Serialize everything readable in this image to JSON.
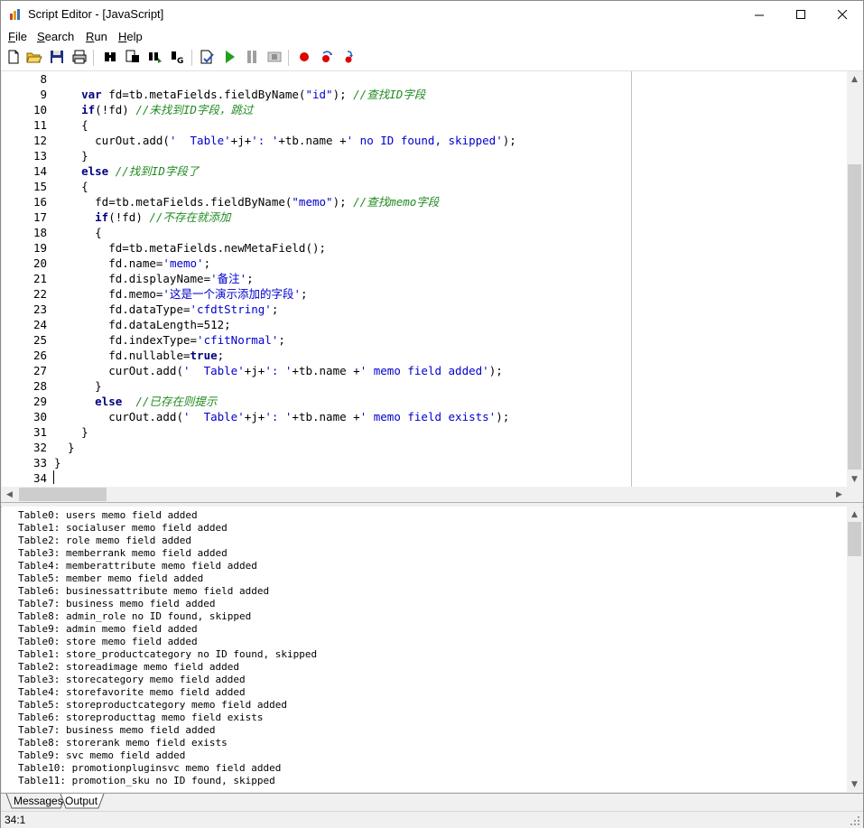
{
  "window": {
    "title": "Script Editor - [JavaScript]",
    "controls": {
      "minimize": "—",
      "maximize": "☐",
      "close": "✕"
    }
  },
  "menu": [
    {
      "label": "File",
      "accel": "F",
      "rest": "ile"
    },
    {
      "label": "Search",
      "accel": "S",
      "rest": "earch"
    },
    {
      "label": "Run",
      "accel": "R",
      "rest": "un"
    },
    {
      "label": "Help",
      "accel": "H",
      "rest": "elp"
    }
  ],
  "toolbar": [
    {
      "name": "new-file-icon"
    },
    {
      "name": "open-folder-icon"
    },
    {
      "name": "save-icon"
    },
    {
      "name": "print-icon"
    },
    {
      "name": "find-icon"
    },
    {
      "name": "find-next-icon"
    },
    {
      "name": "replace-icon"
    },
    {
      "name": "goto-line-icon"
    },
    {
      "name": "check-syntax-icon"
    },
    {
      "name": "run-icon"
    },
    {
      "name": "pause-icon"
    },
    {
      "name": "stop-icon"
    },
    {
      "name": "breakpoint-icon"
    },
    {
      "name": "step-into-icon"
    },
    {
      "name": "step-over-icon"
    }
  ],
  "editor": {
    "lines": [
      {
        "n": "8",
        "t": []
      },
      {
        "n": "9",
        "t": [
          [
            "    ",
            ""
          ],
          [
            "var",
            "kw"
          ],
          [
            " fd=tb.metaFields.fieldByName(",
            ""
          ],
          [
            "\"id\"",
            "str"
          ],
          [
            "); ",
            ""
          ],
          [
            "//查找ID字段",
            "cm"
          ]
        ]
      },
      {
        "n": "10",
        "t": [
          [
            "    ",
            ""
          ],
          [
            "if",
            "kw"
          ],
          [
            "(!fd) ",
            ""
          ],
          [
            "//未找到ID字段，跳过",
            "cm"
          ]
        ]
      },
      {
        "n": "11",
        "t": [
          [
            "    {",
            ""
          ]
        ]
      },
      {
        "n": "12",
        "t": [
          [
            "      curOut.add(",
            ""
          ],
          [
            "'  Table'",
            "str"
          ],
          [
            "+j+",
            ""
          ],
          [
            "': '",
            "str"
          ],
          [
            "+tb.name +",
            ""
          ],
          [
            "' no ID found, skipped'",
            "str"
          ],
          [
            ");",
            ""
          ]
        ]
      },
      {
        "n": "13",
        "t": [
          [
            "    }",
            ""
          ]
        ]
      },
      {
        "n": "14",
        "t": [
          [
            "    ",
            ""
          ],
          [
            "else",
            "kw"
          ],
          [
            " ",
            ""
          ],
          [
            "//找到ID字段了",
            "cm"
          ]
        ]
      },
      {
        "n": "15",
        "t": [
          [
            "    {",
            ""
          ]
        ]
      },
      {
        "n": "16",
        "t": [
          [
            "      fd=tb.metaFields.fieldByName(",
            ""
          ],
          [
            "\"memo\"",
            "str"
          ],
          [
            "); ",
            ""
          ],
          [
            "//查找memo字段",
            "cm"
          ]
        ]
      },
      {
        "n": "17",
        "t": [
          [
            "      ",
            ""
          ],
          [
            "if",
            "kw"
          ],
          [
            "(!fd) ",
            ""
          ],
          [
            "//不存在就添加",
            "cm"
          ]
        ]
      },
      {
        "n": "18",
        "t": [
          [
            "      {",
            ""
          ]
        ]
      },
      {
        "n": "19",
        "t": [
          [
            "        fd=tb.metaFields.newMetaField();",
            ""
          ]
        ]
      },
      {
        "n": "20",
        "t": [
          [
            "        fd.name=",
            ""
          ],
          [
            "'memo'",
            "str"
          ],
          [
            ";",
            ""
          ]
        ]
      },
      {
        "n": "21",
        "t": [
          [
            "        fd.displayName=",
            ""
          ],
          [
            "'备注'",
            "str"
          ],
          [
            ";",
            ""
          ]
        ]
      },
      {
        "n": "22",
        "t": [
          [
            "        fd.memo=",
            ""
          ],
          [
            "'这是一个演示添加的字段'",
            "str"
          ],
          [
            ";",
            ""
          ]
        ]
      },
      {
        "n": "23",
        "t": [
          [
            "        fd.dataType=",
            ""
          ],
          [
            "'cfdtString'",
            "str"
          ],
          [
            ";",
            ""
          ]
        ]
      },
      {
        "n": "24",
        "t": [
          [
            "        fd.dataLength=512;",
            ""
          ]
        ]
      },
      {
        "n": "25",
        "t": [
          [
            "        fd.indexType=",
            ""
          ],
          [
            "'cfitNormal'",
            "str"
          ],
          [
            ";",
            ""
          ]
        ]
      },
      {
        "n": "26",
        "t": [
          [
            "        fd.nullable=",
            ""
          ],
          [
            "true",
            "kw"
          ],
          [
            ";",
            ""
          ]
        ]
      },
      {
        "n": "27",
        "t": [
          [
            "        curOut.add(",
            ""
          ],
          [
            "'  Table'",
            "str"
          ],
          [
            "+j+",
            ""
          ],
          [
            "': '",
            "str"
          ],
          [
            "+tb.name +",
            ""
          ],
          [
            "' memo field added'",
            "str"
          ],
          [
            ");",
            ""
          ]
        ]
      },
      {
        "n": "28",
        "t": [
          [
            "      }",
            ""
          ]
        ]
      },
      {
        "n": "29",
        "t": [
          [
            "      ",
            ""
          ],
          [
            "else",
            "kw"
          ],
          [
            "  ",
            ""
          ],
          [
            "//已存在则提示",
            "cm"
          ]
        ]
      },
      {
        "n": "30",
        "t": [
          [
            "        curOut.add(",
            ""
          ],
          [
            "'  Table'",
            "str"
          ],
          [
            "+j+",
            ""
          ],
          [
            "': '",
            "str"
          ],
          [
            "+tb.name +",
            ""
          ],
          [
            "' memo field exists'",
            "str"
          ],
          [
            ");",
            ""
          ]
        ]
      },
      {
        "n": "31",
        "t": [
          [
            "    }",
            ""
          ]
        ]
      },
      {
        "n": "32",
        "t": [
          [
            "  }",
            ""
          ]
        ]
      },
      {
        "n": "33",
        "t": [
          [
            "}",
            ""
          ]
        ]
      },
      {
        "n": "34",
        "t": []
      }
    ]
  },
  "output": {
    "lines": [
      "Table0: users memo field added",
      "Table1: socialuser memo field added",
      "Table2: role memo field added",
      "Table3: memberrank memo field added",
      "Table4: memberattribute memo field added",
      "Table5: member memo field added",
      "Table6: businessattribute memo field added",
      "Table7: business memo field added",
      "Table8: admin_role no ID found, skipped",
      "Table9: admin memo field added",
      "Table0: store memo field added",
      "Table1: store_productcategory no ID found, skipped",
      "Table2: storeadimage memo field added",
      "Table3: storecategory memo field added",
      "Table4: storefavorite memo field added",
      "Table5: storeproductcategory memo field added",
      "Table6: storeproducttag memo field exists",
      "Table7: business memo field added",
      "Table8: storerank memo field exists",
      "Table9: svc memo field added",
      "Table10: promotionpluginsvc memo field added",
      "Table11: promotion_sku no ID found, skipped"
    ]
  },
  "tabs": [
    {
      "label": "Messages"
    },
    {
      "label": "Output"
    }
  ],
  "status": {
    "position": "34:1"
  }
}
